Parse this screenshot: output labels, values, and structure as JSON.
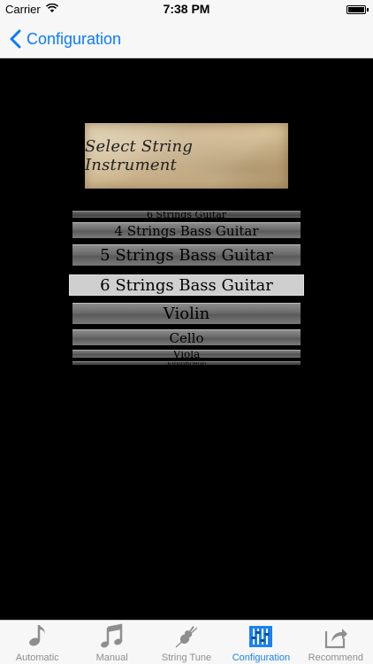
{
  "status": {
    "carrier": "Carrier",
    "time": "7:38 PM"
  },
  "nav": {
    "back_label": "Configuration"
  },
  "header": {
    "title": "Select String Instrument"
  },
  "picker": {
    "items": [
      "6 Strings Guitar",
      "4 Strings Bass Guitar",
      "5 Strings Bass Guitar",
      "6 Strings Bass Guitar",
      "Violin",
      "Cello",
      "Viola",
      "Violoncello"
    ],
    "selected": "6 Strings Bass Guitar"
  },
  "tabs": [
    {
      "label": "Automatic",
      "icon": "note-icon"
    },
    {
      "label": "Manual",
      "icon": "notes-icon"
    },
    {
      "label": "String Tune",
      "icon": "violin-icon"
    },
    {
      "label": "Configuration",
      "icon": "mixer-icon",
      "active": true
    },
    {
      "label": "Recommend",
      "icon": "share-icon"
    }
  ],
  "colors": {
    "accent": "#1a82f0",
    "inactive": "#8e8e8e",
    "background": "#000000"
  }
}
